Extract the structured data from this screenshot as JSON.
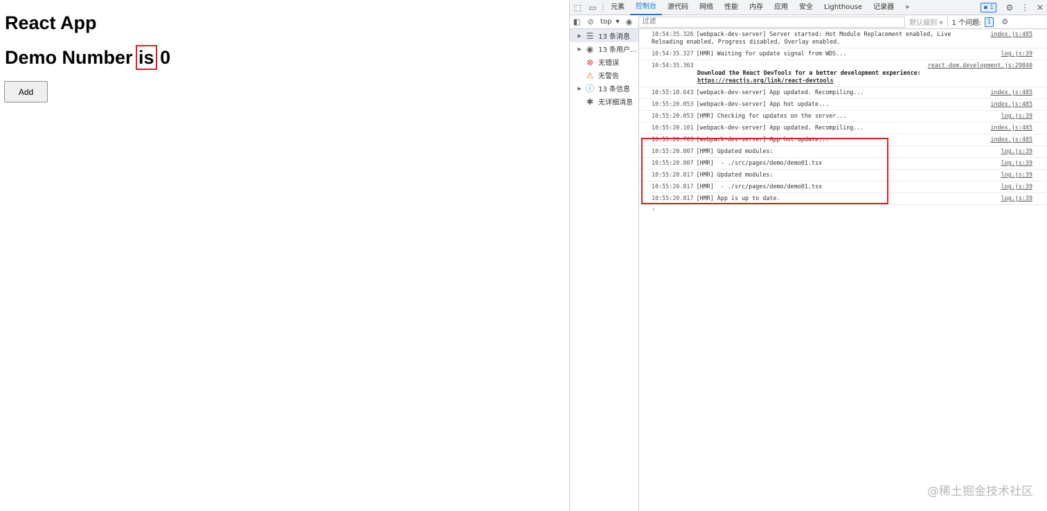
{
  "app": {
    "title": "React App",
    "number_prefix": "Demo Number ",
    "number_highlight": "is",
    "number_value": "0",
    "add_button": "Add"
  },
  "devtools": {
    "tabs": [
      "元素",
      "控制台",
      "源代码",
      "网络",
      "性能",
      "内存",
      "应用",
      "安全",
      "Lighthouse",
      "记录器"
    ],
    "more_tabs": "»",
    "issue_badge": "1",
    "context": "top",
    "filter_placeholder": "过滤",
    "default_levels": "默认级别",
    "issues_label": "1 个问题:",
    "issues_count": "1",
    "sidebar": [
      {
        "label": "13 条消息",
        "icon": "list-icon",
        "arrow": true,
        "selected": true
      },
      {
        "label": "13 条用户…",
        "icon": "user-icon",
        "arrow": true,
        "selected": false
      },
      {
        "label": "无错误",
        "icon": "error-icon",
        "arrow": false,
        "selected": false
      },
      {
        "label": "无警告",
        "icon": "warning-icon",
        "arrow": false,
        "selected": false
      },
      {
        "label": "13 条信息",
        "icon": "info-icon",
        "arrow": true,
        "selected": false
      },
      {
        "label": "无详细消息",
        "icon": "bug-icon",
        "arrow": false,
        "selected": false
      }
    ],
    "logs": [
      {
        "time": "10:54:35.326",
        "msg": "[webpack-dev-server] Server started: Hot Module Replacement enabled, Live Reloading enabled, Progress disabled, Overlay enabled.",
        "src": "index.js:485"
      },
      {
        "time": "10:54:35.327",
        "msg": "[HMR] Waiting for update signal from WDS...",
        "src": "log.js:39"
      },
      {
        "time": "10:54:35.363",
        "msg": "",
        "src": "react-dom.development.js:29840",
        "sub": "Download the React DevTools for a better development experience: ",
        "link": "https://reactjs.org/link/react-devtools"
      },
      {
        "time": "10:55:18.643",
        "msg": "[webpack-dev-server] App updated. Recompiling...",
        "src": "index.js:485"
      },
      {
        "time": "10:55:20.053",
        "msg": "[webpack-dev-server] App hot update...",
        "src": "index.js:485"
      },
      {
        "time": "10:55:20.053",
        "msg": "[HMR] Checking for updates on the server...",
        "src": "log.js:39"
      },
      {
        "time": "10:55:20.101",
        "msg": "[webpack-dev-server] App updated. Recompiling...",
        "src": "index.js:485"
      },
      {
        "time": "10:55:20.763",
        "msg": "[webpack-dev-server] App hot update...",
        "src": "index.js:485"
      },
      {
        "time": "10:55:20.807",
        "msg": "[HMR] Updated modules:",
        "src": "log.js:39"
      },
      {
        "time": "10:55:20.807",
        "msg": "[HMR]  - ./src/pages/demo/demo01.tsx",
        "src": "log.js:39"
      },
      {
        "time": "10:55:20.817",
        "msg": "[HMR] Updated modules:",
        "src": "log.js:39"
      },
      {
        "time": "10:55:20.817",
        "msg": "[HMR]  - ./src/pages/demo/demo01.tsx",
        "src": "log.js:39"
      },
      {
        "time": "10:55:20.817",
        "msg": "[HMR] App is up to date.",
        "src": "log.js:39"
      }
    ],
    "prompt": "›"
  },
  "watermark": "@稀土掘金技术社区"
}
